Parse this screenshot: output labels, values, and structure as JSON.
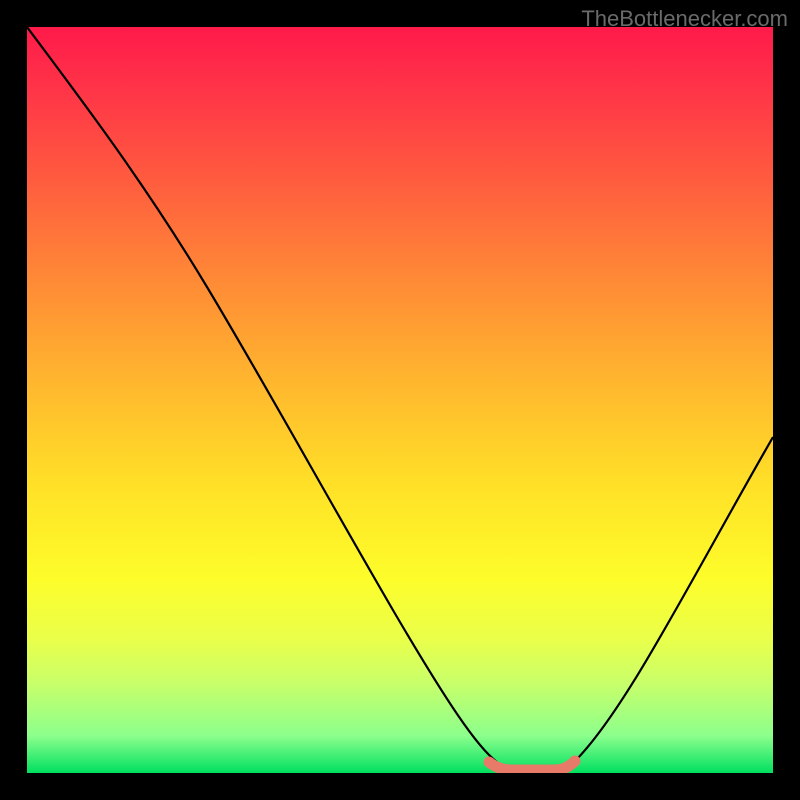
{
  "watermark": "TheBottlenecker.com",
  "chart_data": {
    "type": "line",
    "title": "",
    "xlabel": "",
    "ylabel": "",
    "xlim": [
      0,
      100
    ],
    "ylim": [
      0,
      100
    ],
    "notes": "Gradient background from red (top / high bottleneck) to green (bottom / low bottleneck). Black curve shows bottleneck percentage vs. an x-axis parameter; minimum (optimal region) around x≈62–72 highlighted with a thick salmon segment.",
    "series": [
      {
        "name": "bottleneck-curve",
        "x": [
          0,
          5,
          10,
          15,
          20,
          25,
          30,
          35,
          40,
          45,
          50,
          55,
          60,
          62,
          65,
          68,
          70,
          72,
          75,
          80,
          85,
          90,
          95,
          100
        ],
        "values": [
          100,
          92,
          85,
          78,
          70,
          63,
          55,
          47,
          39,
          31,
          23,
          15,
          7,
          2,
          1,
          1,
          1,
          2,
          6,
          13,
          21,
          29,
          37,
          45
        ]
      }
    ],
    "highlight": {
      "name": "optimal-range",
      "x_start": 62,
      "x_end": 72,
      "y": 1,
      "color": "#e87a6a"
    },
    "gradient_stops": [
      {
        "pos": 0.0,
        "color": "#ff1a4a"
      },
      {
        "pos": 0.5,
        "color": "#ffd228"
      },
      {
        "pos": 0.8,
        "color": "#f5ff3a"
      },
      {
        "pos": 1.0,
        "color": "#00e060"
      }
    ]
  }
}
